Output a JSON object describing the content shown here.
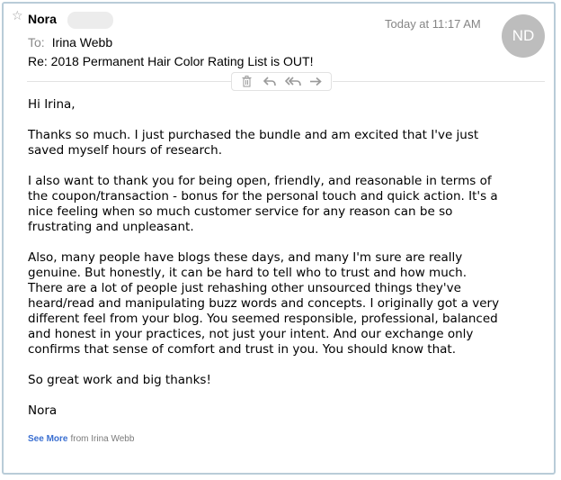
{
  "header": {
    "star_icon": "star-outline-icon",
    "sender_name": "Nora",
    "time": "Today at 11:17 AM",
    "avatar_initials": "ND",
    "to_label": "To:",
    "to_name": "Irina Webb",
    "subject": "Re: 2018 Permanent Hair Color Rating List is OUT!"
  },
  "toolbar": {
    "icons": [
      "trash-icon",
      "reply-icon",
      "reply-all-icon",
      "forward-icon"
    ]
  },
  "body": {
    "paragraphs": [
      "Hi Irina,",
      "Thanks so much.  I just purchased the bundle and am excited that I've just\nsaved myself hours of research.",
      "I also want to thank you for being open, friendly, and reasonable in terms of\nthe coupon/transaction - bonus for the personal touch and quick action.  It's a\nnice feeling when so much customer service for any reason can be so\nfrustrating and unpleasant.",
      "Also, many people have blogs these days, and many I'm sure are really\ngenuine.  But honestly, it can be hard to tell who to trust and how much.\nThere are a lot of people just rehashing other unsourced things they've\nheard/read and manipulating buzz words and concepts.  I originally got a very\ndifferent feel from your blog.  You seemed responsible, professional, balanced\nand honest in your practices, not just your intent.  And our exchange only\nconfirms that sense of comfort and trust in you.  You should know that.",
      "So great work and big thanks!",
      "Nora"
    ]
  },
  "footer": {
    "see_more": "See More",
    "from_text": "from Irina Webb"
  },
  "colors": {
    "avatar_bg": "#bdbdbd",
    "link": "#3a6fd1",
    "frame_border": "#b9ccd8",
    "muted_text": "#858585"
  }
}
